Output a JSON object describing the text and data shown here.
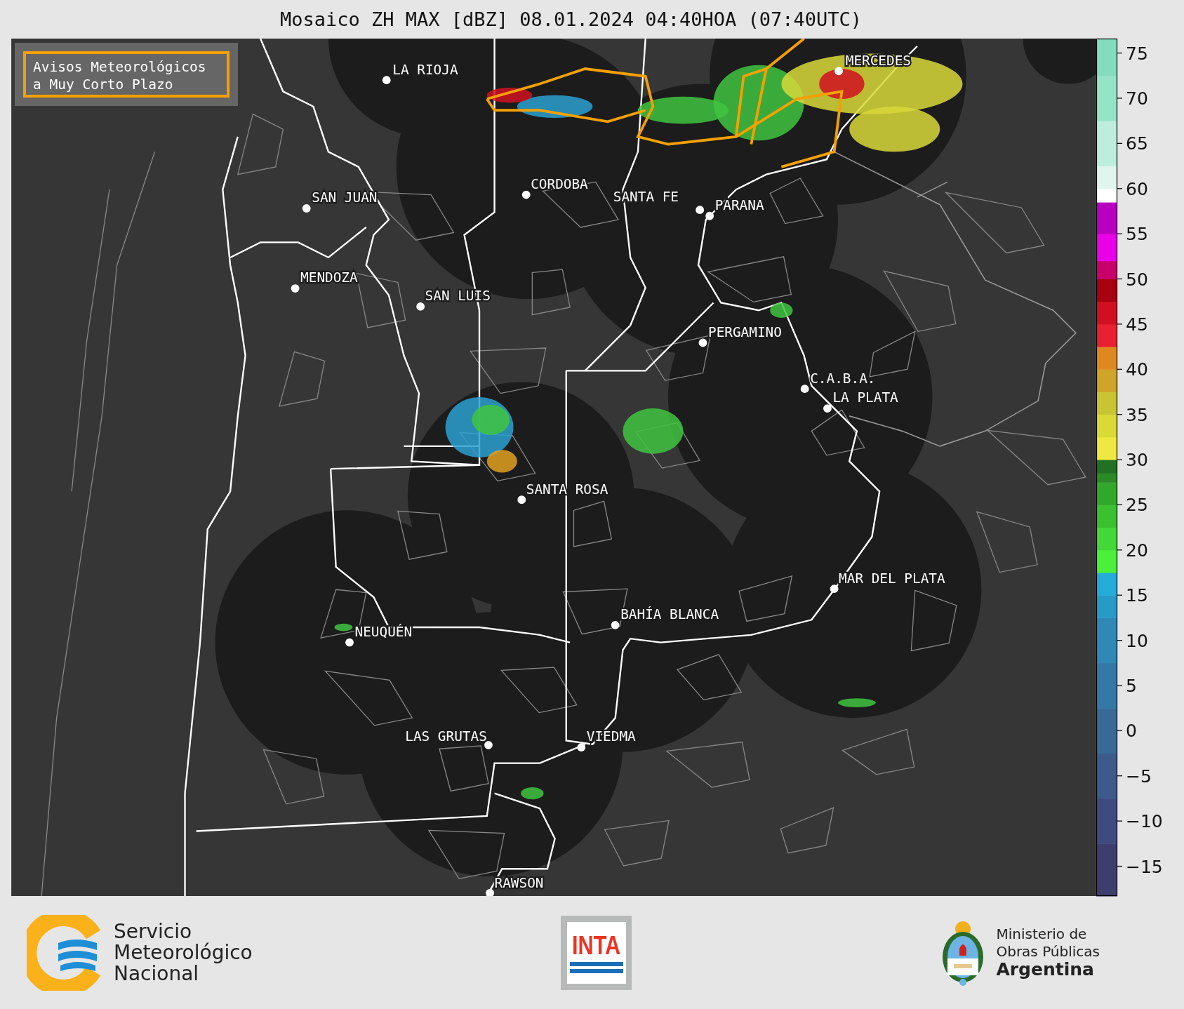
{
  "title": "Mosaico ZH MAX [dBZ] 08.01.2024 04:40HOA (07:40UTC)",
  "warning_legend": [
    "Avisos Meteorológicos",
    "a Muy Corto Plazo"
  ],
  "cities": [
    "LA RIOJA",
    "MERCEDES",
    "CORDOBA",
    "SAN JUAN",
    "SANTA FE",
    "PARANA",
    "MENDOZA",
    "SAN LUIS",
    "PERGAMINO",
    "C.A.B.A.",
    "LA PLATA",
    "SANTA ROSA",
    "MAR DEL PLATA",
    "BAHÍA BLANCA",
    "NEUQUÉN",
    "LAS GRUTAS",
    "VIEDMA",
    "RAWSON"
  ],
  "colorbar": {
    "ticks": [
      "75",
      "70",
      "65",
      "60",
      "55",
      "50",
      "45",
      "40",
      "35",
      "30",
      "25",
      "20",
      "15",
      "10",
      "5",
      "0",
      "−5",
      "−10",
      "−15"
    ]
  },
  "footer": {
    "smn": [
      "Servicio",
      "Meteorológico",
      "Nacional"
    ],
    "inta": "INTA",
    "ministry": [
      "Ministerio de",
      "Obras Públicas",
      "Argentina"
    ]
  }
}
